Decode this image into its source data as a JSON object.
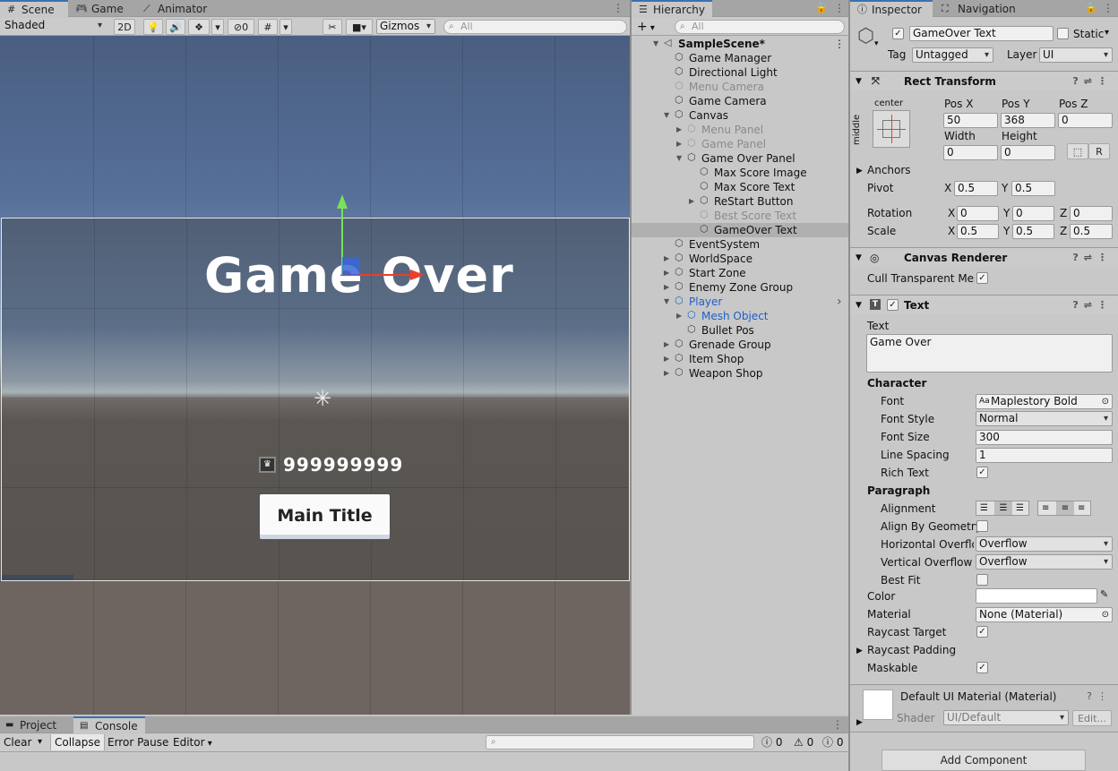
{
  "scene_panel": {
    "tabs": [
      "Scene",
      "Game",
      "Animator"
    ],
    "toolbar": {
      "shading": "Shaded",
      "mode_2d": "2D",
      "hidden_count": "0",
      "gizmos": "Gizmos",
      "search_placeholder": "All"
    },
    "viewport": {
      "title_text": "Game Over",
      "score_text": "999999999",
      "button_text": "Main Title"
    }
  },
  "hierarchy": {
    "tab": "Hierarchy",
    "add_label": "+",
    "search_placeholder": "All",
    "items": [
      {
        "label": "SampleScene*",
        "depth": 0,
        "style": "scene",
        "arrow": "down"
      },
      {
        "label": "Game Manager",
        "depth": 1,
        "style": "normal",
        "arrow": ""
      },
      {
        "label": "Directional Light",
        "depth": 1,
        "style": "normal",
        "arrow": ""
      },
      {
        "label": "Menu Camera",
        "depth": 1,
        "style": "dim",
        "arrow": ""
      },
      {
        "label": "Game Camera",
        "depth": 1,
        "style": "normal",
        "arrow": ""
      },
      {
        "label": "Canvas",
        "depth": 1,
        "style": "normal",
        "arrow": "down"
      },
      {
        "label": "Menu Panel",
        "depth": 2,
        "style": "dim",
        "arrow": "right"
      },
      {
        "label": "Game Panel",
        "depth": 2,
        "style": "dim",
        "arrow": "right"
      },
      {
        "label": "Game Over Panel",
        "depth": 2,
        "style": "normal",
        "arrow": "down"
      },
      {
        "label": "Max Score Image",
        "depth": 3,
        "style": "normal",
        "arrow": ""
      },
      {
        "label": "Max Score Text",
        "depth": 3,
        "style": "normal",
        "arrow": ""
      },
      {
        "label": "ReStart Button",
        "depth": 3,
        "style": "normal",
        "arrow": "right"
      },
      {
        "label": "Best Score Text",
        "depth": 3,
        "style": "dim",
        "arrow": ""
      },
      {
        "label": "GameOver Text",
        "depth": 3,
        "style": "selected",
        "arrow": ""
      },
      {
        "label": "EventSystem",
        "depth": 1,
        "style": "normal",
        "arrow": ""
      },
      {
        "label": "WorldSpace",
        "depth": 1,
        "style": "normal",
        "arrow": "right"
      },
      {
        "label": "Start Zone",
        "depth": 1,
        "style": "normal",
        "arrow": "right"
      },
      {
        "label": "Enemy Zone Group",
        "depth": 1,
        "style": "normal",
        "arrow": "right"
      },
      {
        "label": "Player",
        "depth": 1,
        "style": "blue",
        "arrow": "down"
      },
      {
        "label": "Mesh Object",
        "depth": 2,
        "style": "blue",
        "arrow": "right"
      },
      {
        "label": "Bullet Pos",
        "depth": 2,
        "style": "normal",
        "arrow": ""
      },
      {
        "label": "Grenade Group",
        "depth": 1,
        "style": "normal",
        "arrow": "right"
      },
      {
        "label": "Item Shop",
        "depth": 1,
        "style": "normal",
        "arrow": "right"
      },
      {
        "label": "Weapon Shop",
        "depth": 1,
        "style": "normal",
        "arrow": "right"
      }
    ]
  },
  "inspector": {
    "tabs": [
      "Inspector",
      "Navigation"
    ],
    "object_name": "GameOver Text",
    "static_label": "Static",
    "tag_label": "Tag",
    "tag_value": "Untagged",
    "layer_label": "Layer",
    "layer_value": "UI",
    "rect_transform": {
      "title": "Rect Transform",
      "anchor_h": "center",
      "anchor_v": "middle",
      "posx_label": "Pos X",
      "posy_label": "Pos Y",
      "posz_label": "Pos Z",
      "posx": "50",
      "posy": "368",
      "posz": "0",
      "width_label": "Width",
      "height_label": "Height",
      "width": "0",
      "height": "0",
      "r_button": "R",
      "anchors_label": "Anchors",
      "pivot_label": "Pivot",
      "pivot_x": "0.5",
      "pivot_y": "0.5",
      "rotation_label": "Rotation",
      "rot_x": "0",
      "rot_y": "0",
      "rot_z": "0",
      "scale_label": "Scale",
      "scale_x": "0.5",
      "scale_y": "0.5",
      "scale_z": "0.5",
      "x": "X",
      "y": "Y",
      "z": "Z"
    },
    "canvas_renderer": {
      "title": "Canvas Renderer",
      "cull_label": "Cull Transparent Mes"
    },
    "text": {
      "title": "Text",
      "text_label": "Text",
      "text_value": "Game Over",
      "character_label": "Character",
      "font_label": "Font",
      "font_value": "Maplestory Bold",
      "font_style_label": "Font Style",
      "font_style_value": "Normal",
      "font_size_label": "Font Size",
      "font_size_value": "300",
      "line_spacing_label": "Line Spacing",
      "line_spacing_value": "1",
      "rich_text_label": "Rich Text",
      "paragraph_label": "Paragraph",
      "alignment_label": "Alignment",
      "align_geom_label": "Align By Geometry",
      "h_overflow_label": "Horizontal Overflow",
      "h_overflow_value": "Overflow",
      "v_overflow_label": "Vertical Overflow",
      "v_overflow_value": "Overflow",
      "best_fit_label": "Best Fit",
      "color_label": "Color",
      "color_value": "#ffffff",
      "material_label": "Material",
      "material_value": "None (Material)",
      "raycast_target_label": "Raycast Target",
      "raycast_padding_label": "Raycast Padding",
      "maskable_label": "Maskable"
    },
    "material": {
      "title": "Default UI Material (Material)",
      "shader_label": "Shader",
      "shader_value": "UI/Default",
      "edit_label": "Edit..."
    },
    "add_component": "Add Component"
  },
  "bottom": {
    "tabs": [
      "Project",
      "Console"
    ],
    "clear": "Clear",
    "collapse": "Collapse",
    "error_pause": "Error Pause",
    "editor": "Editor",
    "count_errors": "0",
    "count_warnings": "0",
    "count_logs": "0"
  },
  "colors": {
    "selection": "#b0b0b0",
    "accent_blue": "#3a72b0",
    "player_blue": "#1d5fc8",
    "gizmo_green": "#7ae05a",
    "gizmo_red": "#e8402a",
    "gizmo_blue": "#3a66d8"
  }
}
